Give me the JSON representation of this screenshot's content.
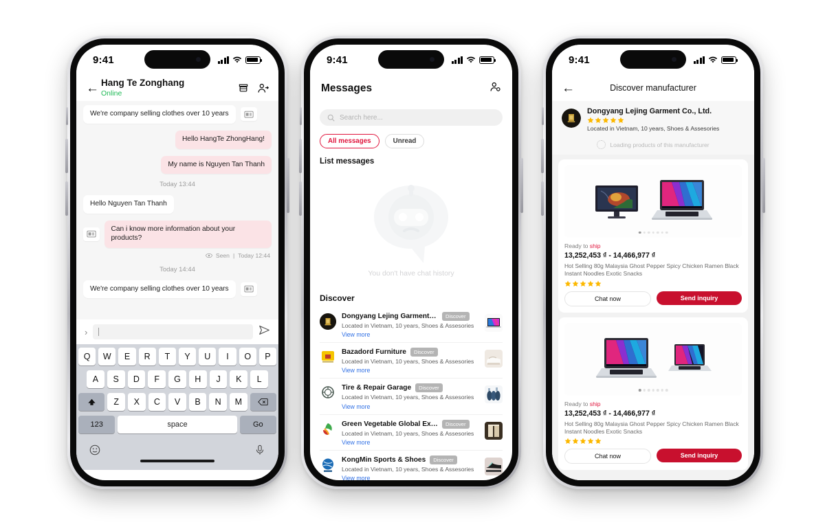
{
  "status_bar": {
    "time": "9:41"
  },
  "phone1": {
    "header": {
      "back_icon": "back-arrow-icon",
      "title": "Hang Te Zonghang",
      "status": "Online",
      "store_icon": "store-icon",
      "add_contact_icon": "person-add-icon"
    },
    "messages": [
      {
        "side": "left",
        "text": "We're company selling clothes over 10 years",
        "attachment": true
      },
      {
        "side": "right",
        "text": "Hello HangTe ZhongHang!",
        "attachment": false
      },
      {
        "side": "right",
        "text": "My name is Nguyen Tan Thanh",
        "attachment": false
      }
    ],
    "timestamp1": "Today 13:44",
    "message4": {
      "side": "left",
      "text": "Hello Nguyen Tan Thanh"
    },
    "message5": {
      "side": "right",
      "text": "Can i know more information about your products?",
      "attachment": true
    },
    "seen": {
      "label": "Seen",
      "separator": "|",
      "time": "Today 12:44",
      "icon": "eye-icon"
    },
    "timestamp2": "Today 14:44",
    "message6": {
      "side": "left",
      "text": "We're company selling clothes over 10 years",
      "attachment": true
    },
    "input": {
      "placeholder": "",
      "value": "",
      "expand_icon": "chevron-right-icon",
      "send_icon": "send-plane-icon"
    },
    "keyboard": {
      "row1": [
        "Q",
        "W",
        "E",
        "R",
        "T",
        "Y",
        "U",
        "I",
        "O",
        "P"
      ],
      "row2": [
        "A",
        "S",
        "D",
        "F",
        "G",
        "H",
        "J",
        "K",
        "L"
      ],
      "row3": [
        "Z",
        "X",
        "C",
        "V",
        "B",
        "N",
        "M"
      ],
      "shift": "shift-icon",
      "backspace": "backspace-icon",
      "numbers": "123",
      "space": "space",
      "go": "Go",
      "emoji_icon": "emoji-icon",
      "mic_icon": "microphone-icon"
    }
  },
  "phone2": {
    "header": {
      "title": "Messages",
      "add_contact_icon": "person-settings-icon"
    },
    "search": {
      "placeholder": "Search here...",
      "icon": "search-icon"
    },
    "filters": [
      {
        "label": "All messages",
        "active": true
      },
      {
        "label": "Unread",
        "active": false
      }
    ],
    "list_title": "List messages",
    "empty_state": {
      "text": "You don't have chat history",
      "icon": "sad-robot-icon"
    },
    "discover_title": "Discover",
    "discover_items": [
      {
        "name": "Dongyang Lejing Garment Co.,...",
        "badge": "Discover",
        "sub": "Located in Vietnam, 10 years, Shoes & Assesories",
        "link": "View more",
        "logo": "gold-emblem-logo",
        "thumb": "laptop-thumb"
      },
      {
        "name": "Bazadord Furniture",
        "badge": "Discover",
        "sub": "Located in Vietnam, 10 years, Shoes & Assesories",
        "link": "View more",
        "logo": "yellow-square-logo",
        "thumb": "furniture-thumb"
      },
      {
        "name": "Tire & Repair Garage",
        "badge": "Discover",
        "sub": "Located in Vietnam, 10 years, Shoes & Assesories",
        "link": "View more",
        "logo": "circular-gear-logo",
        "thumb": "tire-thumb"
      },
      {
        "name": "Green Vegetable Global Export",
        "badge": "Discover",
        "sub": "Located in Vietnam, 10 years, Shoes & Assesories",
        "link": "View more",
        "logo": "green-leaf-logo",
        "thumb": "package-thumb"
      },
      {
        "name": "KongMin Sports & Shoes",
        "badge": "Discover",
        "sub": "Located in Vietnam, 10 years, Shoes & Assesories",
        "link": "View more",
        "logo": "blue-globe-logo",
        "thumb": "sneakers-thumb"
      }
    ]
  },
  "phone3": {
    "header": {
      "back_icon": "back-arrow-icon",
      "title": "Discover manufacturer"
    },
    "manufacturer": {
      "name": "Dongyang Lejing Garment Co., Ltd.",
      "rating": 5,
      "location": "Located in Vietnam, 10 years, Shoes & Assesories",
      "logo": "gold-emblem-logo"
    },
    "loading": {
      "text": "Loading products of this manufacturer",
      "icon": "spinner-icon"
    },
    "products": [
      {
        "ready_prefix": "Ready to ",
        "ready_suffix": "ship",
        "price": "13,252,453 ₫ - 14,466,977 ₫",
        "description": "Hot Selling 80g Malaysia Ghost Pepper Spicy Chicken Ramen Black Instant Noodles Exotic Snacks",
        "rating": 5,
        "chat_label": "Chat now",
        "inquiry_label": "Send inquiry",
        "dots_total": 7,
        "dots_active": 0
      },
      {
        "ready_prefix": "Ready to ",
        "ready_suffix": "ship",
        "price": "13,252,453 ₫ - 14,466,977 ₫",
        "description": "Hot Selling 80g Malaysia Ghost Pepper Spicy Chicken Ramen Black Instant Noodles Exotic Snacks",
        "rating": 5,
        "chat_label": "Chat now",
        "inquiry_label": "Send inquiry",
        "dots_total": 7,
        "dots_active": 0
      }
    ]
  },
  "colors": {
    "accent_red": "#e0143c",
    "button_red": "#c8102e",
    "online_green": "#1db954",
    "bubble_pink": "#fbe3e6",
    "link_blue": "#2f6fe4",
    "star_gold": "#fcb800"
  }
}
